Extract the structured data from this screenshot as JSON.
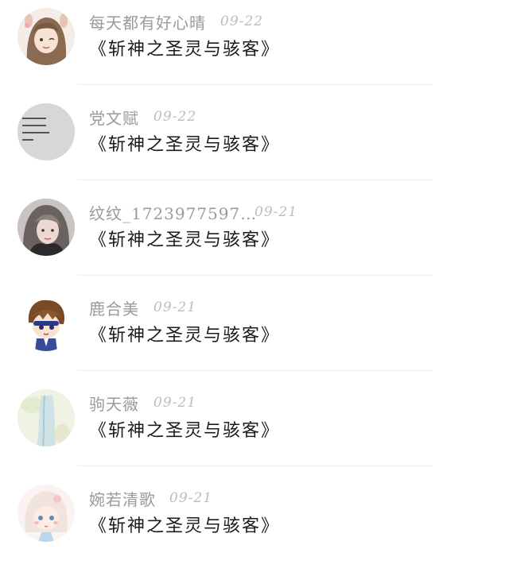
{
  "comments": [
    {
      "name": "每天都有好心晴",
      "date": "09-22",
      "title": "《斩神之圣灵与骇客》",
      "avatar": "girl-with-bunny-ears-avatar"
    },
    {
      "name": "党文赋",
      "date": "09-22",
      "title": "《斩神之圣灵与骇客》",
      "avatar": "text-poem-avatar"
    },
    {
      "name": "纹纹_1723977597…",
      "date": "09-21",
      "title": "《斩神之圣灵与骇客》",
      "avatar": "photo-girl-avatar"
    },
    {
      "name": "鹿合美",
      "date": "09-21",
      "title": "《斩神之圣灵与骇客》",
      "avatar": "chibi-boy-avatar"
    },
    {
      "name": "驹天薇",
      "date": "09-21",
      "title": "《斩神之圣灵与骇客》",
      "avatar": "pastel-illustration-avatar"
    },
    {
      "name": "婉若清歌",
      "date": "09-21",
      "title": "《斩神之圣灵与骇客》",
      "avatar": "cute-anime-girl-avatar"
    }
  ]
}
